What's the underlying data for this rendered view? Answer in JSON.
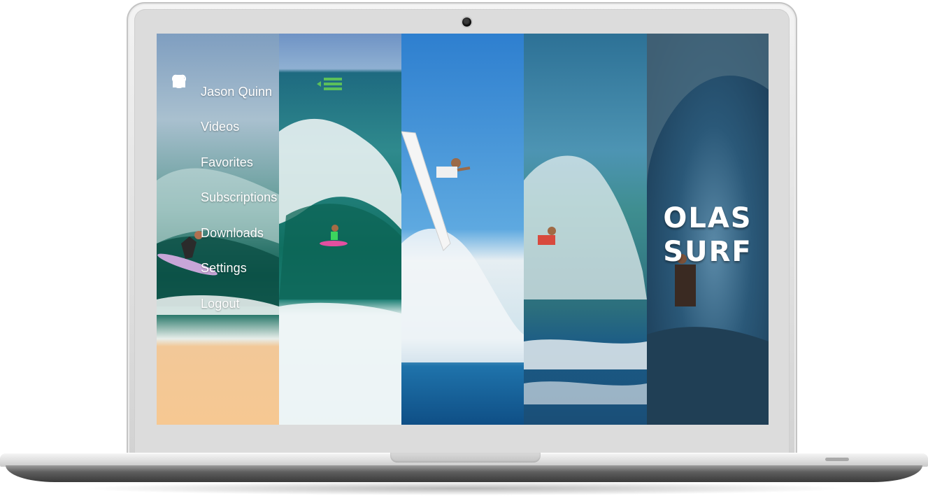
{
  "menu": {
    "items": [
      {
        "label": "Jason Quinn",
        "icon": "user-icon"
      },
      {
        "label": "Videos",
        "icon": "video-camera-icon"
      },
      {
        "label": "Favorites",
        "icon": "heart-icon"
      },
      {
        "label": "Subscriptions",
        "icon": "megaphone-icon"
      },
      {
        "label": "Downloads",
        "icon": "download-tray-icon"
      },
      {
        "label": "Settings",
        "icon": "sliders-icon"
      },
      {
        "label": "Logout",
        "icon": "power-icon"
      }
    ]
  },
  "header": {
    "menu_toggle_icon": "hamburger-menu-icon",
    "accent_color": "#5cc05a"
  },
  "brand": {
    "logo_line1": "OLAS",
    "logo_line2": "SURF"
  }
}
